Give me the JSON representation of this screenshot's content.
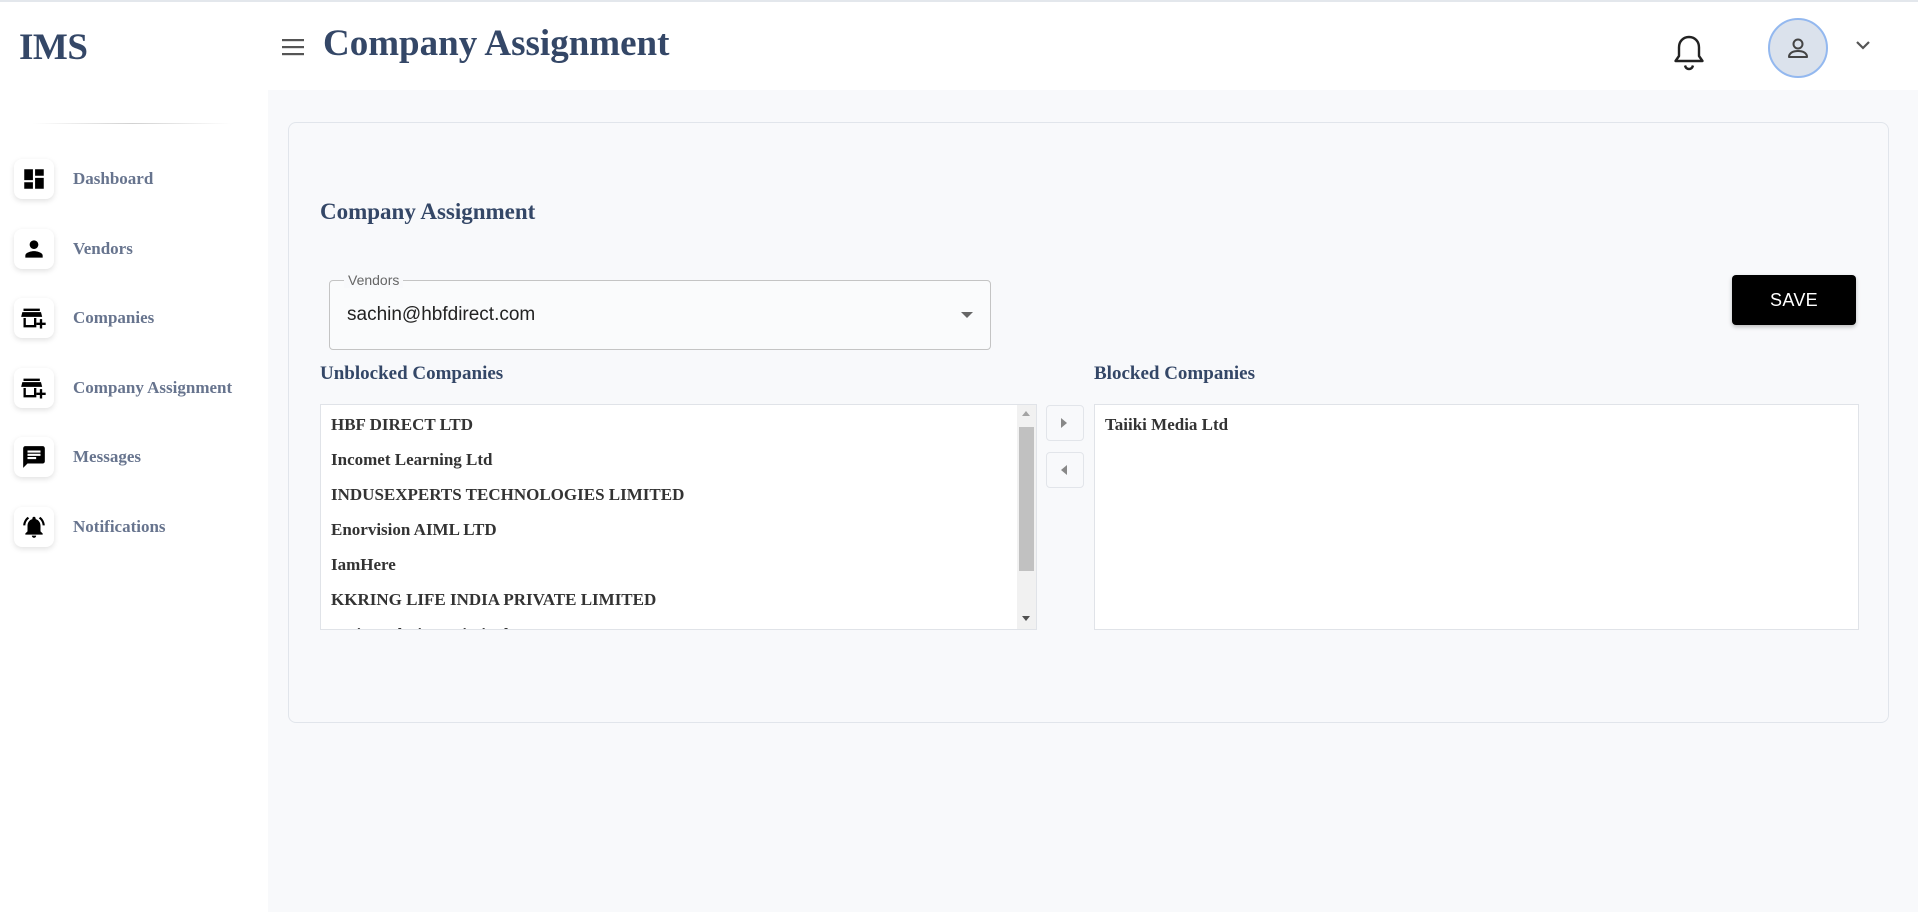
{
  "app": {
    "brand": "IMS"
  },
  "header": {
    "title": "Company Assignment"
  },
  "sidebar": {
    "items": [
      {
        "label": "Dashboard",
        "icon": "dashboard-icon"
      },
      {
        "label": "Vendors",
        "icon": "person-icon"
      },
      {
        "label": "Companies",
        "icon": "store-add-icon"
      },
      {
        "label": "Company Assignment",
        "icon": "store-add-icon"
      },
      {
        "label": "Messages",
        "icon": "chat-icon"
      },
      {
        "label": "Notifications",
        "icon": "bell-active-icon"
      }
    ]
  },
  "main": {
    "title": "Company Assignment",
    "vendor_select": {
      "label": "Vendors",
      "value": "sachin@hbfdirect.com"
    },
    "save_label": "SAVE",
    "unblocked": {
      "title": "Unblocked Companies",
      "items": [
        "HBF DIRECT LTD",
        "Incomet Learning Ltd",
        "INDUSEXPERTS TECHNOLOGIES LIMITED",
        "Enorvision AIML LTD",
        "IamHere",
        "KKRING LIFE INDIA PRIVATE LIMITED",
        "Qwise Solutions Limited"
      ]
    },
    "blocked": {
      "title": "Blocked Companies",
      "items": [
        "Taiiki Media Ltd"
      ]
    }
  },
  "colors": {
    "primary_text": "#344767",
    "nav_text": "#67748e",
    "save_bg": "#000000",
    "avatar_border": "#93b8ef"
  }
}
